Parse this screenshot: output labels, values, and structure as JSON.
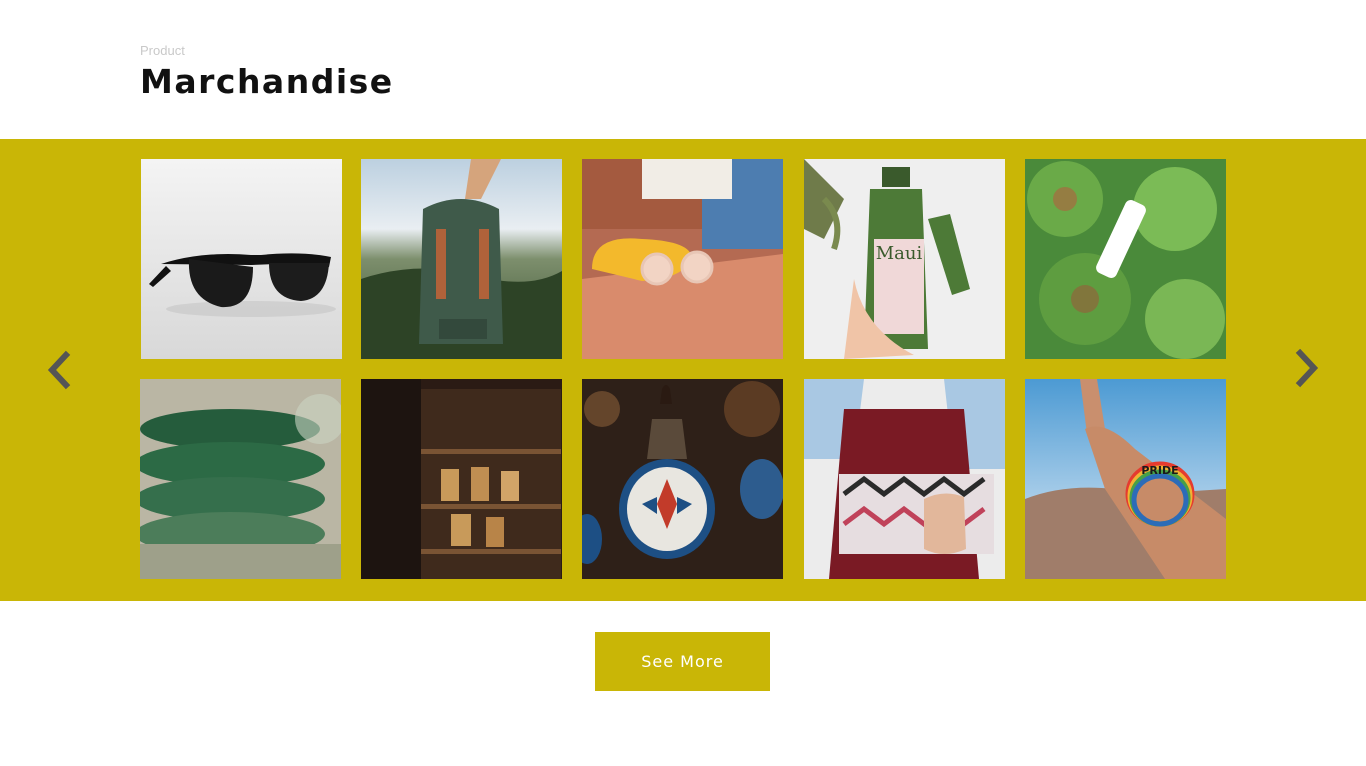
{
  "header": {
    "eyebrow": "Product",
    "title": "Marchandise"
  },
  "colors": {
    "accent": "#c9b606",
    "arrow": "#555555",
    "title": "#111111",
    "eyebrow": "#c9c9c9"
  },
  "carousel": {
    "prev_icon": "chevron-left-icon",
    "next_icon": "chevron-right-icon",
    "products": [
      {
        "name": "product-sunglasses-black"
      },
      {
        "name": "product-backpack"
      },
      {
        "name": "product-sunglasses-yellow-case"
      },
      {
        "name": "product-shampoo-bottles",
        "label": "Maui"
      },
      {
        "name": "product-succulents-tube"
      },
      {
        "name": "product-ceramic-bowls"
      },
      {
        "name": "product-shop-shelves"
      },
      {
        "name": "product-mosaic-lamp"
      },
      {
        "name": "product-clutch-bag"
      },
      {
        "name": "product-pride-bracelet",
        "label": "PRIDE"
      }
    ]
  },
  "actions": {
    "see_more_label": "See More"
  }
}
